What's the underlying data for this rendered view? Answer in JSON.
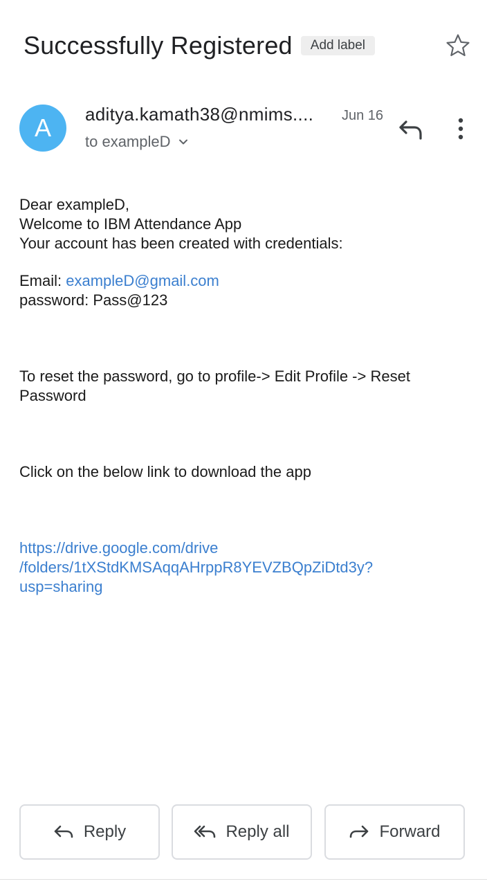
{
  "email": {
    "subject": "Successfully Registered",
    "add_label": "Add label",
    "sender_initial": "A",
    "sender": "aditya.kamath38@nmims....",
    "date": "Jun 16",
    "recipient": "to exampleD"
  },
  "body": {
    "greeting": "Dear exampleD,",
    "welcome": "Welcome to IBM Attendance App",
    "account_line": "Your account has been created with credentials:",
    "email_label": "Email: ",
    "email_value": "exampleD@gmail.com",
    "password_line": "password: Pass@123",
    "reset_line": "To reset the password, go to profile-> Edit Profile -> Reset Password",
    "download_line": "Click on the below link to download the app",
    "link_line1": "https://drive.google.com/drive",
    "link_line2": "/folders/1tXStdKMSAqqAHrppR8YEVZBQpZiDtd3y?",
    "link_line3": "usp=sharing"
  },
  "actions": {
    "reply": "Reply",
    "reply_all": "Reply all",
    "forward": "Forward"
  },
  "icons": {
    "star": "star-outline-icon",
    "reply": "reply-icon",
    "more": "more-vertical-icon",
    "chevron": "chevron-down-icon",
    "reply_all": "reply-all-icon",
    "forward": "forward-icon"
  },
  "colors": {
    "avatar": "#4db4f2",
    "link": "#3b7fcf",
    "chip_bg": "#eeeeee"
  }
}
